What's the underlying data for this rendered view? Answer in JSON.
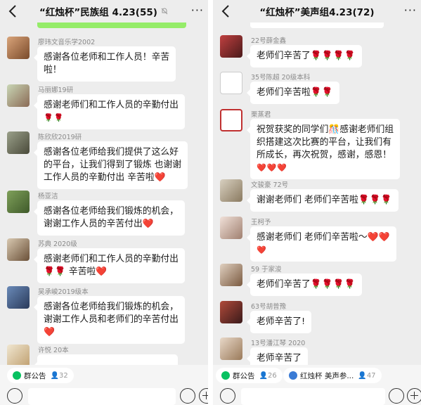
{
  "left": {
    "title": "“红烛杯”民族组 4.23(55)",
    "messages": [
      {
        "name": "廖玮文音乐学2002",
        "lines": [
          "感谢各位老师和工作人员！辛苦",
          "啦！"
        ]
      },
      {
        "name": "马丽娜19研",
        "lines": [
          "感谢老师们和工作人员的辛勤付出",
          "🌹🌹"
        ]
      },
      {
        "name": "陈欣欣2019研",
        "lines": [
          "感谢各位老师给我们提供了这么好",
          "的平台，让我们得到了锻炼 也谢谢",
          "工作人员的辛勤付出 辛苦啦❤️"
        ]
      },
      {
        "name": "杨亚洁",
        "lines": [
          "感谢各位老师给我们锻炼的机会，",
          "谢谢工作人员的辛苦付出❤️"
        ]
      },
      {
        "name": "苏典 2020级",
        "lines": [
          "感谢老师们和工作人员的辛勤付出",
          "🌹🌹 辛苦啦❤️"
        ]
      },
      {
        "name": "吴承峻2019级本",
        "lines": [
          "感谢各位老师给我们锻炼的机会，",
          "谢谢工作人员和老师们的辛苦付出",
          "❤️"
        ]
      },
      {
        "name": "许悦 20本",
        "lines": []
      }
    ],
    "announcement": {
      "label": "群公告",
      "count": "32"
    }
  },
  "right": {
    "title": "“红烛杯”美声组4.23(72)",
    "messages": [
      {
        "name": "22号薛金鑫",
        "lines": [
          "老师们辛苦了🌹🌹🌹🌹"
        ]
      },
      {
        "name": "35号陈超 20级本科",
        "lines": [
          "老师们辛苦啦🌹🌹"
        ]
      },
      {
        "name": "栗蒸君",
        "lines": [
          "祝贺获奖的同学们🎊感谢老师们组",
          "织搭建这次比赛的平台，让我们有",
          "所成长，再次祝贺，感谢，感恩！",
          "❤️❤️❤️"
        ]
      },
      {
        "name": "文骏豪 72号",
        "lines": [
          "谢谢老师们 老师们辛苦啦🌹🌹🌹"
        ]
      },
      {
        "name": "王柯予",
        "lines": [
          "感谢老师们 老师们辛苦啦～❤️❤️",
          "❤️"
        ]
      },
      {
        "name": "59 于家浚",
        "lines": [
          "老师们辛苦了🌹🌹🌹🌹"
        ]
      },
      {
        "name": "63号胡普豫",
        "lines": [
          "老师辛苦了!"
        ]
      },
      {
        "name": "13号潘江琴 2020",
        "lines": [
          "老师辛苦了"
        ]
      }
    ],
    "announcement": {
      "label": "群公告",
      "count": "26"
    },
    "pinned": {
      "label": "红烛杯 美声参...",
      "count": "47"
    }
  }
}
